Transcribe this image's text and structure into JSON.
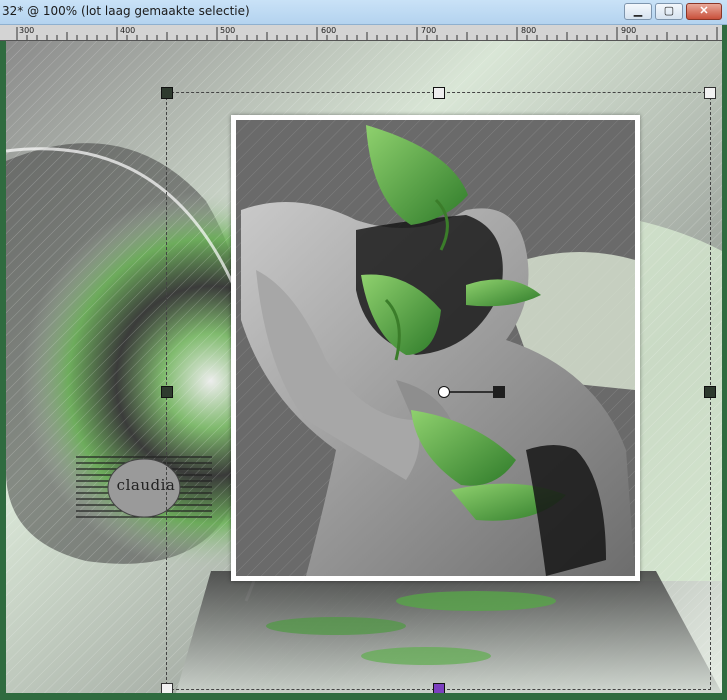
{
  "window": {
    "title": "32* @ 100% (lot laag gemaakte selectie)",
    "buttons": {
      "minimize": "▁",
      "maximize": "▢",
      "close": "✕"
    }
  },
  "ruler": {
    "labels": [
      "300",
      "400",
      "500",
      "600",
      "700",
      "800",
      "900"
    ]
  },
  "canvas": {
    "watermark_text": "claudia",
    "accent_color": "#5fae4e",
    "frame_color": "#ffffff"
  },
  "icons": {
    "rotate": "rotate-handle-icon",
    "move": "move-handle-icon"
  }
}
